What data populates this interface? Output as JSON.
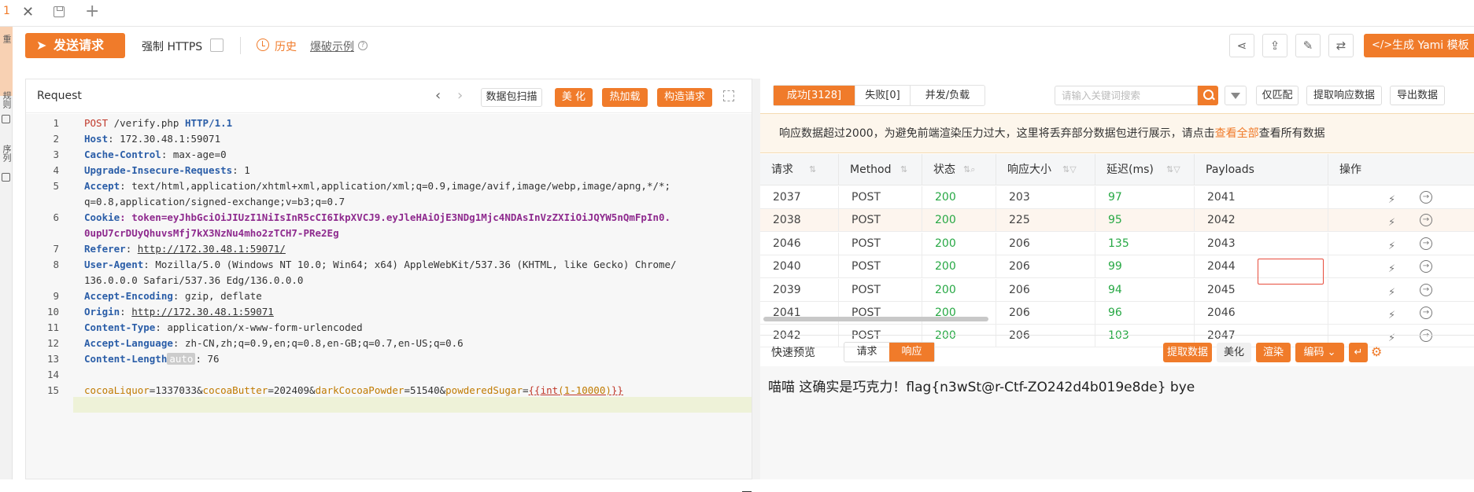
{
  "tab": {
    "number": "1"
  },
  "left_rail": {
    "items": [
      "重",
      "规则",
      "序列"
    ]
  },
  "toolbar": {
    "send_label": "发送请求",
    "force_https_label": "强制 HTTPS",
    "history_label": "历史",
    "example_label": "爆破示例",
    "yami_label": "生成 Yami 模板"
  },
  "request_panel": {
    "title": "Request",
    "buttons": {
      "scan": "数据包扫描",
      "beautify": "美 化",
      "hot_load": "热加载",
      "build": "构造请求"
    },
    "lines": [
      {
        "n": "1",
        "method": "POST",
        "path": " /verify.php ",
        "proto": "HTTP/1.1"
      },
      {
        "n": "2",
        "key": "Host",
        "value": ": 172.30.48.1:59071"
      },
      {
        "n": "3",
        "key": "Cache-Control",
        "value": ": max-age=0"
      },
      {
        "n": "4",
        "key": "Upgrade-Insecure-Requests",
        "value": ": 1"
      },
      {
        "n": "5",
        "key": "Accept",
        "value": ": text/html,application/xhtml+xml,application/xml;q=0.9,image/avif,image/webp,image/apng,*/*;"
      },
      {
        "n": "",
        "cont": "q=0.8,application/signed-exchange;v=b3;q=0.7"
      },
      {
        "n": "6",
        "key": "Cookie",
        "ckname": ": token",
        "ckval": "=eyJhbGciOiJIUzI1NiIsInR5cCI6IkpXVCJ9.eyJleHAiOjE3NDg1Mjc4NDAsInVzZXIiOiJQYW5nQmFpIn0."
      },
      {
        "n": "",
        "cont": "0upU7crDUyQhuvsMfj7kX3NzNu4mho2zTCH7-PRe2Eg"
      },
      {
        "n": "7",
        "key": "Referer",
        "value": ": ",
        "link": "http://172.30.48.1:59071/"
      },
      {
        "n": "8",
        "key": "User-Agent",
        "value": ": Mozilla/5.0 (Windows NT 10.0; Win64; x64) AppleWebKit/537.36 (KHTML, like Gecko) Chrome/"
      },
      {
        "n": "",
        "cont": "136.0.0.0 Safari/537.36 Edg/136.0.0.0"
      },
      {
        "n": "9",
        "key": "Accept-Encoding",
        "value": ": gzip, deflate"
      },
      {
        "n": "10",
        "key": "Origin",
        "value": ": ",
        "link": "http://172.30.48.1:59071"
      },
      {
        "n": "11",
        "key": "Content-Type",
        "value": ": application/x-www-form-urlencoded"
      },
      {
        "n": "12",
        "key": "Accept-Language",
        "value": ": zh-CN,zh;q=0.9,en;q=0.8,en-GB;q=0.7,en-US;q=0.6"
      },
      {
        "n": "13",
        "key": "Content-Length",
        "auto": "auto",
        "value": ": 76"
      },
      {
        "n": "14"
      },
      {
        "n": "15",
        "body": true
      }
    ],
    "body_params": [
      {
        "k": "cocoaLiquor",
        "v": "=1337033"
      },
      {
        "k": "cocoaButter",
        "v": "=202409"
      },
      {
        "k": "darkCocoaPowder",
        "v": "=51540"
      },
      {
        "k": "powderedSugar",
        "v": "="
      }
    ],
    "template": {
      "open": "{{",
      "fn": "int",
      "arg": "(1-10000)",
      "close": "}}"
    },
    "separators": [
      "&",
      "&",
      "&"
    ]
  },
  "results": {
    "tabs": [
      "成功[3128]",
      "失败[0]",
      "并发/负载"
    ],
    "search_placeholder": "请输入关键词搜索",
    "buttons": {
      "only_match": "仅匹配",
      "extract": "提取响应数据",
      "export": "导出数据"
    },
    "notice_before": "响应数据超过2000，为避免前端渲染压力过大，这里将丢弃部分数据包进行展示，请点击",
    "notice_link": "查看全部",
    "notice_after": "查看所有数据",
    "columns": [
      "请求",
      "Method",
      "状态",
      "响应大小",
      "延迟(ms)",
      "Payloads",
      "操作"
    ],
    "rows": [
      {
        "req": "2037",
        "method": "POST",
        "status": "200",
        "size": "203",
        "delay": "97",
        "payload": "2041"
      },
      {
        "req": "2038",
        "method": "POST",
        "status": "200",
        "size": "225",
        "delay": "95",
        "payload": "2042"
      },
      {
        "req": "2046",
        "method": "POST",
        "status": "200",
        "size": "206",
        "delay": "135",
        "payload": "2043"
      },
      {
        "req": "2040",
        "method": "POST",
        "status": "200",
        "size": "206",
        "delay": "99",
        "payload": "2044"
      },
      {
        "req": "2039",
        "method": "POST",
        "status": "200",
        "size": "206",
        "delay": "94",
        "payload": "2045"
      },
      {
        "req": "2041",
        "method": "POST",
        "status": "200",
        "size": "206",
        "delay": "96",
        "payload": "2046"
      },
      {
        "req": "2042",
        "method": "POST",
        "status": "200",
        "size": "206",
        "delay": "103",
        "payload": "2047"
      }
    ],
    "selected_row": 1,
    "preview": {
      "label": "快速预览",
      "tabs": [
        "请求",
        "响应"
      ],
      "buttons": {
        "extract": "提取数据",
        "beautify": "美化",
        "render": "渲染",
        "encode": "编码"
      },
      "body": "喵喵 这确实是巧克力！flag{n3wSt@r-Ctf-ZO242d4b019e8de} bye"
    }
  },
  "colors": {
    "accent": "#f07b2a",
    "ok": "#27a844",
    "select": "#e74c3c"
  }
}
